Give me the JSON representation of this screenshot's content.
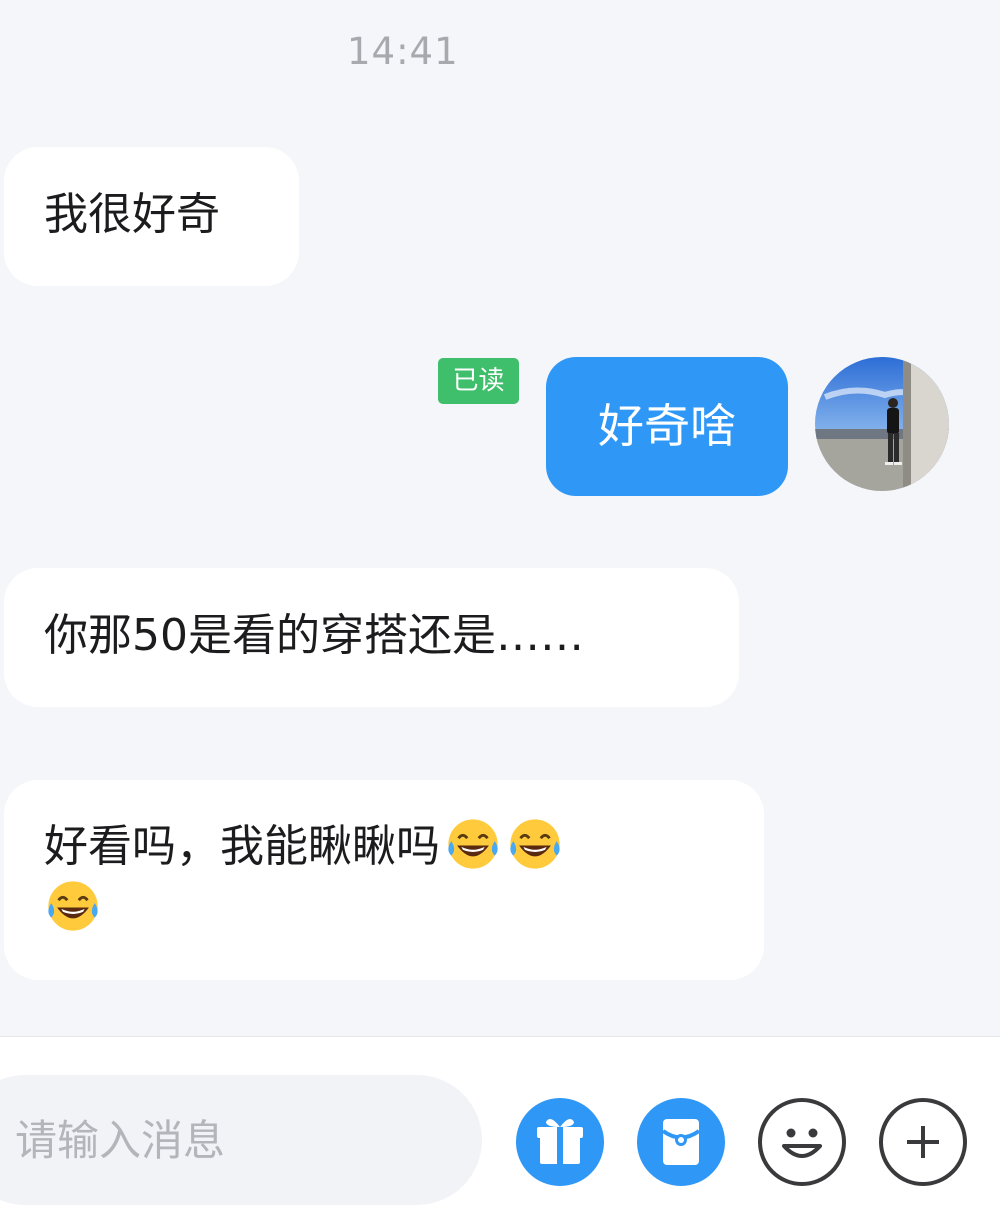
{
  "chat": {
    "timestamp": "14:41",
    "messages": [
      {
        "text": "我很好奇"
      },
      {
        "text": "好奇啥",
        "status": "已读"
      },
      {
        "text": "你那50是看的穿搭还是……"
      },
      {
        "text": "好看吗，我能瞅瞅吗",
        "emojis": [
          "laughing-tears-emoji",
          "laughing-tears-emoji",
          "laughing-tears-emoji"
        ]
      }
    ]
  },
  "input": {
    "placeholder": "请输入消息"
  },
  "toolbar": {
    "buttons": [
      "gift-icon",
      "red-packet-icon",
      "smiley-icon",
      "plus-icon"
    ]
  },
  "colors": {
    "accent": "#2f98f6",
    "read_badge": "#3fbe6b",
    "background": "#f5f6f9"
  }
}
